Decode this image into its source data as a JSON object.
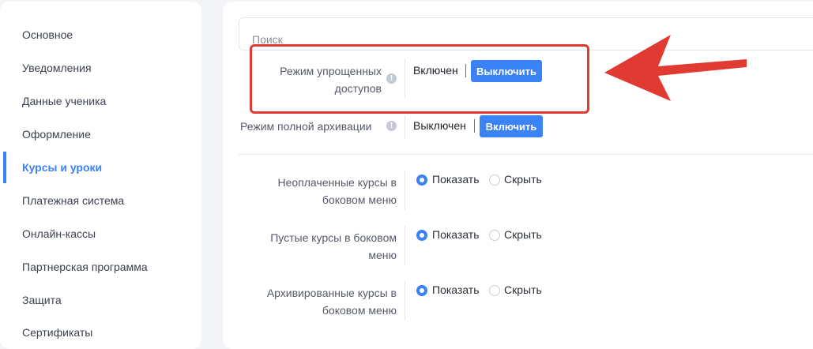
{
  "sidebar": {
    "items": [
      {
        "label": "Основное"
      },
      {
        "label": "Уведомления"
      },
      {
        "label": "Данные ученика"
      },
      {
        "label": "Оформление"
      },
      {
        "label": "Курсы и уроки",
        "active": true
      },
      {
        "label": "Платежная система"
      },
      {
        "label": "Онлайн-кассы"
      },
      {
        "label": "Партнерская программа"
      },
      {
        "label": "Защита"
      },
      {
        "label": "Сертификаты"
      }
    ]
  },
  "search": {
    "placeholder": "Поиск"
  },
  "settings": {
    "simplified_access": {
      "label": "Режим упрощенных доступов",
      "status": "Включен",
      "button": "Выключить"
    },
    "full_archive": {
      "label": "Режим полной архивации",
      "status": "Выключен",
      "button": "Включить"
    }
  },
  "menu_options": {
    "show_label": "Показать",
    "hide_label": "Скрыть",
    "rows": [
      {
        "label": "Неоплаченные курсы в боковом меню",
        "selected": "show"
      },
      {
        "label": "Пустые курсы в боковом меню",
        "selected": "show"
      },
      {
        "label": "Архивированные курсы в боковом меню",
        "selected": "show"
      }
    ]
  },
  "annotation": {
    "color": "#e03a33"
  },
  "colors": {
    "accent": "#3b82f6",
    "annotation": "#e03a33"
  }
}
